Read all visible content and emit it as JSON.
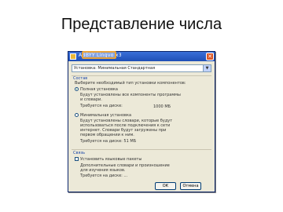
{
  "slide": {
    "title": "Представление числа"
  },
  "dialog": {
    "title": "ABBYY Lingvo x3",
    "dropdown_value": "Установка: Минимальная Стандартная",
    "section1_heading": "Состав",
    "section1_intro": "Выберите необходимый тип установки компонентов:",
    "option_full_label": "Полная установка",
    "option_full_desc1": "Будут установлены все компоненты программы",
    "option_full_desc2": "и словари.",
    "option_full_required": "Требуется на диске:",
    "option_full_size": "1000 МБ",
    "option_min_label": "Минимальная установка",
    "option_min_desc1": "Будут установлены словари, которые будут",
    "option_min_desc2": "использоваться после подключения к сети",
    "option_min_desc3": "интернет. Словари будут загружены при",
    "option_min_desc4": "первом обращении к ним.",
    "option_min_required": "Требуется на диске: 51 МБ",
    "section2_heading": "Связь",
    "checkbox_label": "Установить языковые пакеты",
    "checkbox_desc1": "Дополнительные словари и произношение",
    "checkbox_desc2": "для изучения языков.",
    "checkbox_required": "Требуется на диске: ...",
    "ok_label": "ОК",
    "cancel_label": "Отмена"
  }
}
